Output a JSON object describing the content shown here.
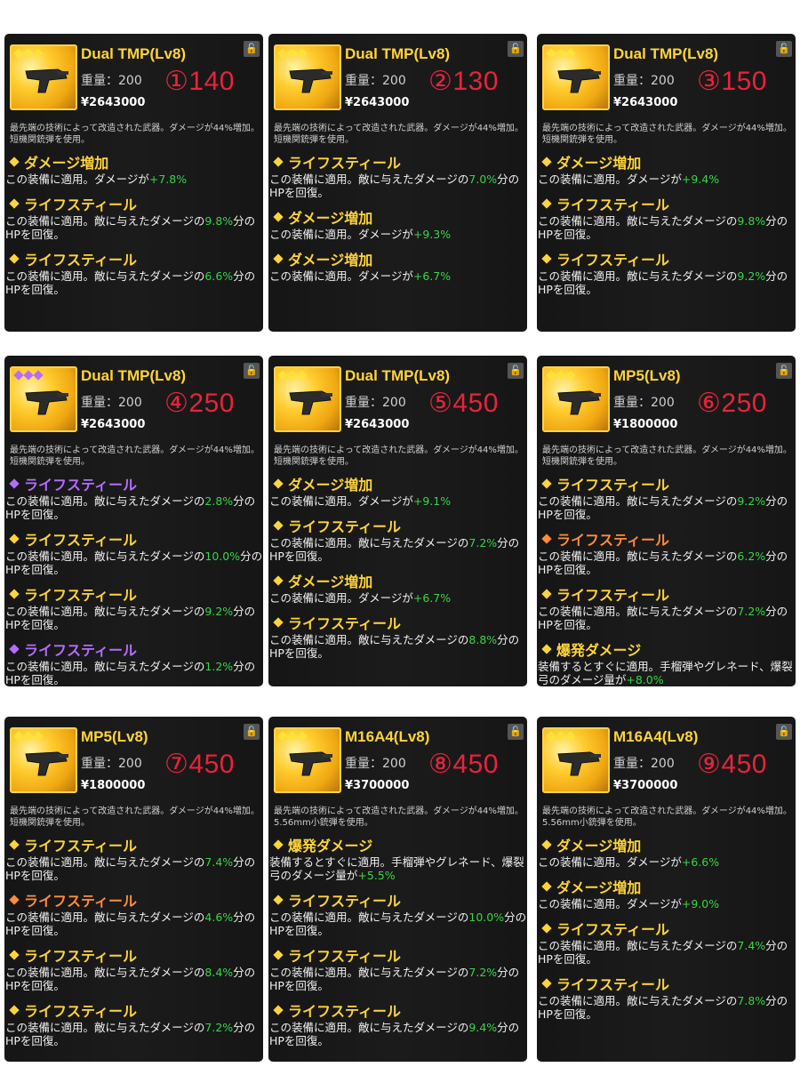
{
  "common": {
    "weight_label": "重量：200",
    "description_a": "最先端の技術によって改造された武器。ダメージが44%増加。短機関銃弾を使用。",
    "description_b": "最先端の技術によって改造された武器。ダメージが44%増加。5.56mm小銃弾を使用。"
  },
  "colors": {
    "gold": "#ffd43a",
    "purple": "#b56cff",
    "orange": "#ff8c3c",
    "green_value": "#36d646",
    "score_red": "#e8233b"
  },
  "cards": [
    {
      "name": "Dual TMP(Lv8)",
      "score": "①140",
      "price": "¥2643000",
      "description": "最先端の技術によって改造された武器。ダメージが44%増加。短機関銃弾を使用。",
      "rarity": "gold",
      "options": [
        {
          "title": "ダメージ増加",
          "color": "gold",
          "body": "この装備に適用。ダメージが",
          "value": "+7.8%",
          "after": ""
        },
        {
          "title": "ライフスティール",
          "color": "gold",
          "body": "この装備に適用。敵に与えたダメージの",
          "value": "9.8%",
          "after": "分のHPを回復。"
        },
        {
          "title": "ライフスティール",
          "color": "gold",
          "body": "この装備に適用。敵に与えたダメージの",
          "value": "6.6%",
          "after": "分のHPを回復。"
        }
      ]
    },
    {
      "name": "Dual TMP(Lv8)",
      "score": "②130",
      "price": "¥2643000",
      "description": "最先端の技術によって改造された武器。ダメージが44%増加。短機関銃弾を使用。",
      "rarity": "gold",
      "options": [
        {
          "title": "ライフスティール",
          "color": "gold",
          "body": "この装備に適用。敵に与えたダメージの",
          "value": "7.0%",
          "after": "分のHPを回復。"
        },
        {
          "title": "ダメージ増加",
          "color": "gold",
          "body": "この装備に適用。ダメージが",
          "value": "+9.3%",
          "after": ""
        },
        {
          "title": "ダメージ増加",
          "color": "gold",
          "body": "この装備に適用。ダメージが",
          "value": "+6.7%",
          "after": ""
        }
      ]
    },
    {
      "name": "Dual TMP(Lv8)",
      "score": "③150",
      "price": "¥2643000",
      "description": "最先端の技術によって改造された武器。ダメージが44%増加。短機関銃弾を使用。",
      "rarity": "gold",
      "options": [
        {
          "title": "ダメージ増加",
          "color": "gold",
          "body": "この装備に適用。ダメージが",
          "value": "+9.4%",
          "after": ""
        },
        {
          "title": "ライフスティール",
          "color": "gold",
          "body": "この装備に適用。敵に与えたダメージの",
          "value": "9.8%",
          "after": "分のHPを回復。"
        },
        {
          "title": "ライフスティール",
          "color": "gold",
          "body": "この装備に適用。敵に与えたダメージの",
          "value": "9.2%",
          "after": "分のHPを回復。"
        }
      ]
    },
    {
      "name": "Dual TMP(Lv8)",
      "score": "④250",
      "price": "¥2643000",
      "description": "最先端の技術によって改造された武器。ダメージが44%増加。短機関銃弾を使用。",
      "rarity": "purple",
      "options": [
        {
          "title": "ライフスティール",
          "color": "purple",
          "body": "この装備に適用。敵に与えたダメージの",
          "value": "2.8%",
          "after": "分のHPを回復。"
        },
        {
          "title": "ライフスティール",
          "color": "gold",
          "body": "この装備に適用。敵に与えたダメージの",
          "value": "10.0%",
          "after": "分のHPを回復。"
        },
        {
          "title": "ライフスティール",
          "color": "gold",
          "body": "この装備に適用。敵に与えたダメージの",
          "value": "9.2%",
          "after": "分のHPを回復。"
        },
        {
          "title": "ライフスティール",
          "color": "purple",
          "body": "この装備に適用。敵に与えたダメージの",
          "value": "1.2%",
          "after": "分のHPを回復。"
        }
      ]
    },
    {
      "name": "Dual TMP(Lv8)",
      "score": "⑤450",
      "price": "¥2643000",
      "description": "最先端の技術によって改造された武器。ダメージが44%増加。短機関銃弾を使用。",
      "rarity": "gold",
      "options": [
        {
          "title": "ダメージ増加",
          "color": "gold",
          "body": "この装備に適用。ダメージが",
          "value": "+9.1%",
          "after": ""
        },
        {
          "title": "ライフスティール",
          "color": "gold",
          "body": "この装備に適用。敵に与えたダメージの",
          "value": "7.2%",
          "after": "分のHPを回復。"
        },
        {
          "title": "ダメージ増加",
          "color": "gold",
          "body": "この装備に適用。ダメージが",
          "value": "+6.7%",
          "after": ""
        },
        {
          "title": "ライフスティール",
          "color": "gold",
          "body": "この装備に適用。敵に与えたダメージの",
          "value": "8.8%",
          "after": "分のHPを回復。"
        }
      ]
    },
    {
      "name": "MP5(Lv8)",
      "score": "⑥250",
      "price": "¥1800000",
      "description": "最先端の技術によって改造された武器。ダメージが44%増加。短機関銃弾を使用。",
      "rarity": "gold",
      "options": [
        {
          "title": "ライフスティール",
          "color": "gold",
          "body": "この装備に適用。敵に与えたダメージの",
          "value": "9.2%",
          "after": "分のHPを回復。"
        },
        {
          "title": "ライフスティール",
          "color": "orange",
          "body": "この装備に適用。敵に与えたダメージの",
          "value": "6.2%",
          "after": "分のHPを回復。"
        },
        {
          "title": "ライフスティール",
          "color": "gold",
          "body": "この装備に適用。敵に与えたダメージの",
          "value": "7.2%",
          "after": "分のHPを回復。"
        },
        {
          "title": "爆発ダメージ",
          "color": "gold",
          "body": "装備するとすぐに適用。手榴弾やグレネード、爆裂弓のダメージ量が",
          "value": "+8.0%",
          "after": ""
        }
      ]
    },
    {
      "name": "MP5(Lv8)",
      "score": "⑦450",
      "price": "¥1800000",
      "description": "最先端の技術によって改造された武器。ダメージが44%増加。短機関銃弾を使用。",
      "rarity": "gold",
      "options": [
        {
          "title": "ライフスティール",
          "color": "gold",
          "body": "この装備に適用。敵に与えたダメージの",
          "value": "7.4%",
          "after": "分のHPを回復。"
        },
        {
          "title": "ライフスティール",
          "color": "orange",
          "body": "この装備に適用。敵に与えたダメージの",
          "value": "4.6%",
          "after": "分のHPを回復。"
        },
        {
          "title": "ライフスティール",
          "color": "gold",
          "body": "この装備に適用。敵に与えたダメージの",
          "value": "8.4%",
          "after": "分のHPを回復。"
        },
        {
          "title": "ライフスティール",
          "color": "gold",
          "body": "この装備に適用。敵に与えたダメージの",
          "value": "7.2%",
          "after": "分のHPを回復。"
        }
      ]
    },
    {
      "name": "M16A4(Lv8)",
      "score": "⑧450",
      "price": "¥3700000",
      "description": "最先端の技術によって改造された武器。ダメージが44%増加。5.56mm小銃弾を使用。",
      "rarity": "gold",
      "options": [
        {
          "title": "爆発ダメージ",
          "color": "gold",
          "body": "装備するとすぐに適用。手榴弾やグレネード、爆裂弓のダメージ量が",
          "value": "+5.5%",
          "after": ""
        },
        {
          "title": "ライフスティール",
          "color": "gold",
          "body": "この装備に適用。敵に与えたダメージの",
          "value": "10.0%",
          "after": "分のHPを回復。"
        },
        {
          "title": "ライフスティール",
          "color": "gold",
          "body": "この装備に適用。敵に与えたダメージの",
          "value": "7.2%",
          "after": "分のHPを回復。"
        },
        {
          "title": "ライフスティール",
          "color": "gold",
          "body": "この装備に適用。敵に与えたダメージの",
          "value": "9.4%",
          "after": "分のHPを回復。"
        }
      ]
    },
    {
      "name": "M16A4(Lv8)",
      "score": "⑨450",
      "price": "¥3700000",
      "description": "最先端の技術によって改造された武器。ダメージが44%増加。5.56mm小銃弾を使用。",
      "rarity": "gold",
      "options": [
        {
          "title": "ダメージ増加",
          "color": "gold",
          "body": "この装備に適用。ダメージが",
          "value": "+6.6%",
          "after": ""
        },
        {
          "title": "ダメージ増加",
          "color": "gold",
          "body": "この装備に適用。ダメージが",
          "value": "+9.0%",
          "after": ""
        },
        {
          "title": "ライフスティール",
          "color": "gold",
          "body": "この装備に適用。敵に与えたダメージの",
          "value": "7.4%",
          "after": "分のHPを回復。"
        },
        {
          "title": "ライフスティール",
          "color": "gold",
          "body": "この装備に適用。敵に与えたダメージの",
          "value": "7.8%",
          "after": "分のHPを回復。"
        }
      ]
    }
  ]
}
